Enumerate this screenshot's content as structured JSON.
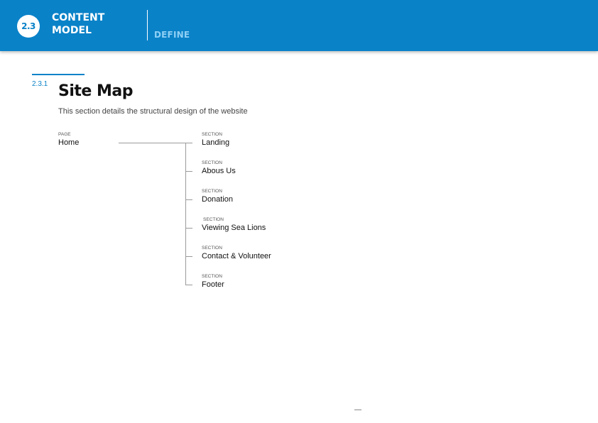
{
  "header": {
    "section_number": "2.3",
    "section_title_line1": "CONTENT",
    "section_title_line2": "MODEL",
    "stage": "DEFINE"
  },
  "subsection": {
    "number": "2.3.1",
    "title": "Site Map",
    "description": "This section details the structural design of the website"
  },
  "sitemap": {
    "root": {
      "type": "PAGE",
      "label": "Home"
    },
    "sections": [
      {
        "type": "SECTION",
        "label": "Landing"
      },
      {
        "type": "SECTION",
        "label": "Abous Us"
      },
      {
        "type": "SECTION",
        "label": "Donation"
      },
      {
        "type": "SECTION",
        "label": "Viewing Sea Lions"
      },
      {
        "type": "SECTION",
        "label": "Contact & Volunteer"
      },
      {
        "type": "SECTION",
        "label": "Footer"
      }
    ]
  },
  "colors": {
    "brand_blue": "#0a82c8",
    "stage_text": "#8fd0f5",
    "connector": "#9a9a9a"
  }
}
